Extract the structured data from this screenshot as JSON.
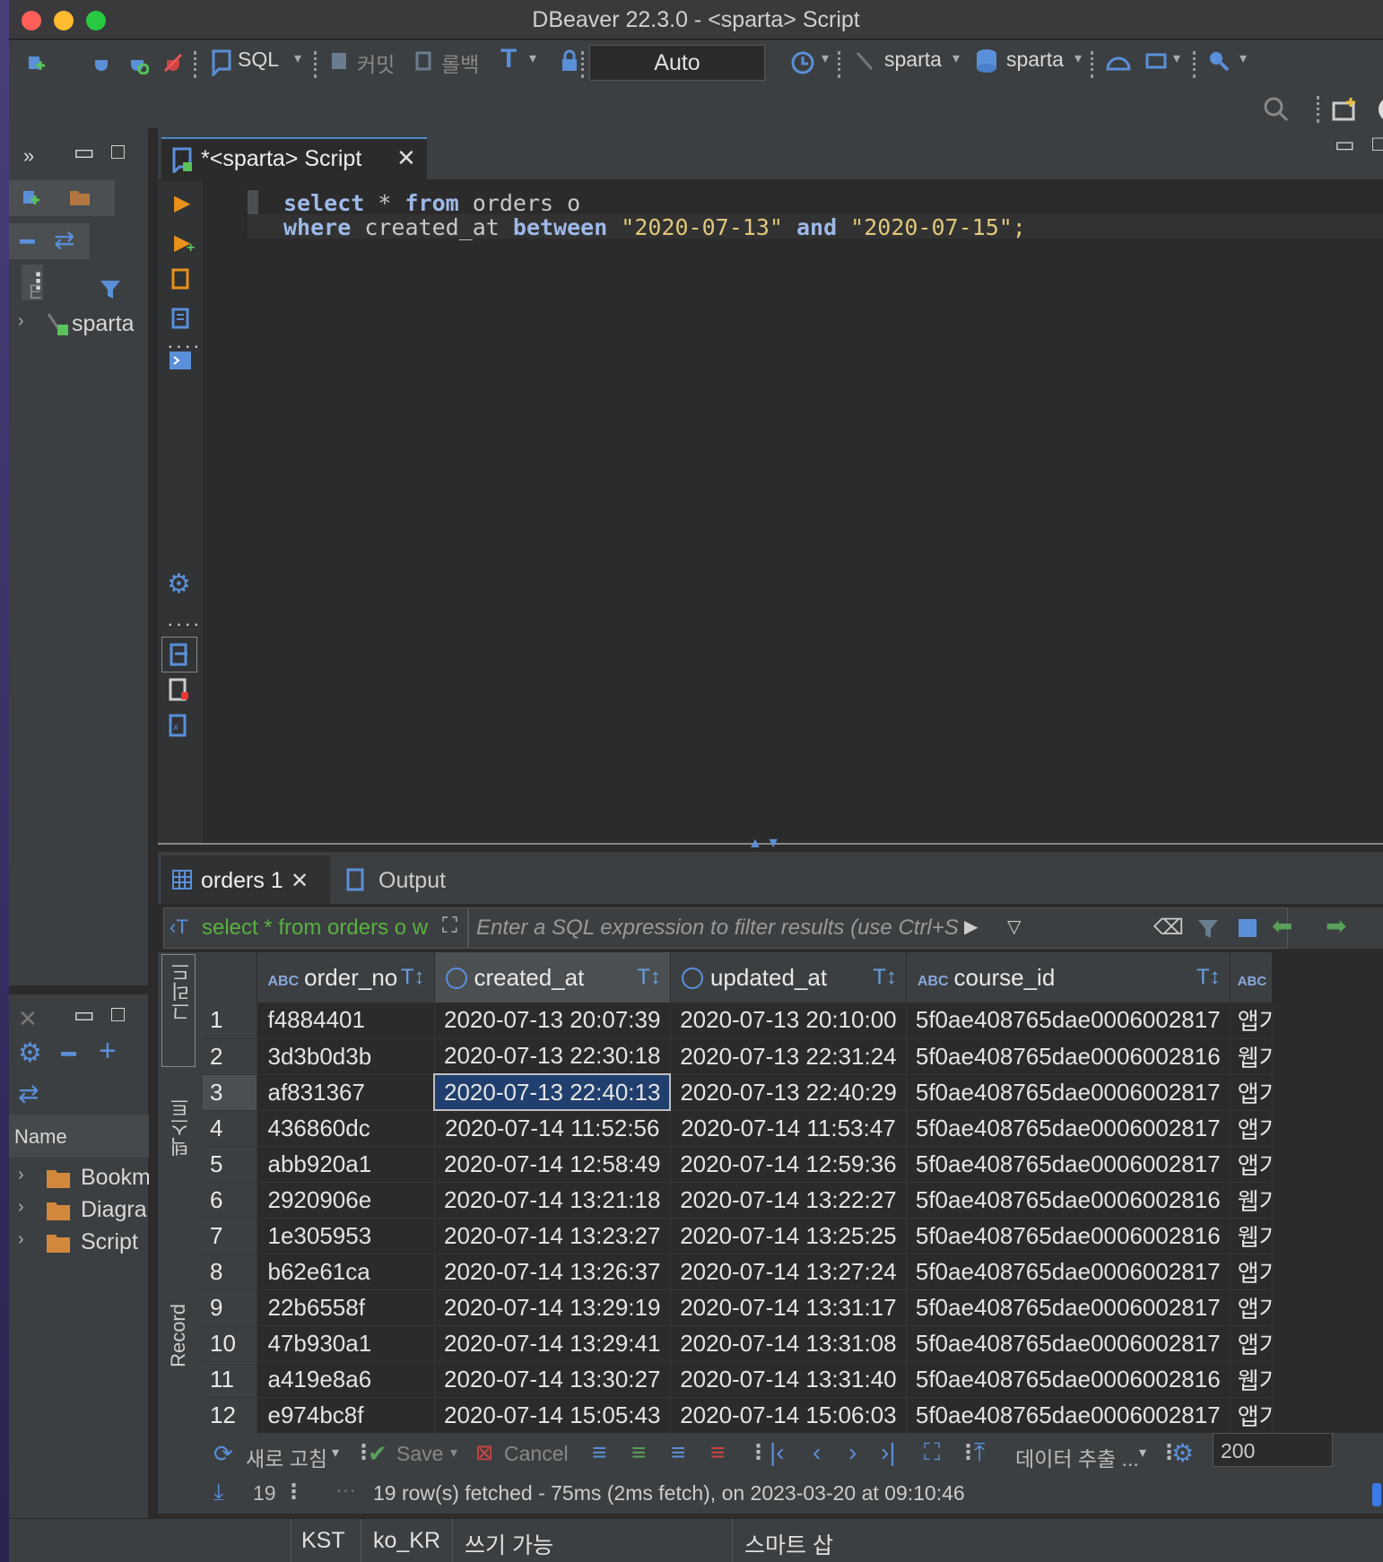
{
  "window": {
    "title": "DBeaver 22.3.0 - <sparta> Script"
  },
  "toolbar": {
    "sql_label": "SQL",
    "commit_label": "커밋",
    "rollback_label": "롤백",
    "transaction_mode": "Auto",
    "connection_name": "sparta",
    "schema_name": "sparta"
  },
  "left_panel": {
    "filter_letter": "E",
    "tree_root": "sparta",
    "projects_header": "Name",
    "project_items": [
      "Bookm",
      "Diagra",
      "Script"
    ]
  },
  "editor": {
    "tab_label": "*<sparta> Script",
    "sql_line1": {
      "kw1": "select",
      "star": " * ",
      "kw2": "from",
      "rest": " orders o"
    },
    "sql_line2": {
      "kw1": "where",
      "col": " created_at ",
      "kw2": "between",
      "s1": " \"2020-07-13\" ",
      "kw3": "and",
      "s2": " \"2020-07-15\";"
    }
  },
  "results": {
    "tab_label": "orders 1",
    "output_tab_label": "Output",
    "query_preview": "select * from orders o w",
    "filter_placeholder": "Enter a SQL expression to filter results (use Ctrl+S",
    "side_grid_label": "그리드",
    "side_text_label": "텍스트",
    "side_record_label": "Record",
    "columns": [
      "order_no",
      "created_at",
      "updated_at",
      "course_id",
      "ABC"
    ],
    "rows": [
      {
        "n": "1",
        "order_no": "f4884401",
        "created_at": "2020-07-13 20:07:39",
        "updated_at": "2020-07-13 20:10:00",
        "course_id": "5f0ae408765dae0006002817",
        "x": "앱기"
      },
      {
        "n": "2",
        "order_no": "3d3b0d3b",
        "created_at": "2020-07-13 22:30:18",
        "updated_at": "2020-07-13 22:31:24",
        "course_id": "5f0ae408765dae0006002816",
        "x": "웹기"
      },
      {
        "n": "3",
        "order_no": "af831367",
        "created_at": "2020-07-13 22:40:13",
        "updated_at": "2020-07-13 22:40:29",
        "course_id": "5f0ae408765dae0006002817",
        "x": "앱기"
      },
      {
        "n": "4",
        "order_no": "436860dc",
        "created_at": "2020-07-14 11:52:56",
        "updated_at": "2020-07-14 11:53:47",
        "course_id": "5f0ae408765dae0006002817",
        "x": "앱기"
      },
      {
        "n": "5",
        "order_no": "abb920a1",
        "created_at": "2020-07-14 12:58:49",
        "updated_at": "2020-07-14 12:59:36",
        "course_id": "5f0ae408765dae0006002817",
        "x": "앱기"
      },
      {
        "n": "6",
        "order_no": "2920906e",
        "created_at": "2020-07-14 13:21:18",
        "updated_at": "2020-07-14 13:22:27",
        "course_id": "5f0ae408765dae0006002816",
        "x": "웹기"
      },
      {
        "n": "7",
        "order_no": "1e305953",
        "created_at": "2020-07-14 13:23:27",
        "updated_at": "2020-07-14 13:25:25",
        "course_id": "5f0ae408765dae0006002816",
        "x": "웹기"
      },
      {
        "n": "8",
        "order_no": "b62e61ca",
        "created_at": "2020-07-14 13:26:37",
        "updated_at": "2020-07-14 13:27:24",
        "course_id": "5f0ae408765dae0006002817",
        "x": "앱기"
      },
      {
        "n": "9",
        "order_no": "22b6558f",
        "created_at": "2020-07-14 13:29:19",
        "updated_at": "2020-07-14 13:31:17",
        "course_id": "5f0ae408765dae0006002817",
        "x": "앱기"
      },
      {
        "n": "10",
        "order_no": "47b930a1",
        "created_at": "2020-07-14 13:29:41",
        "updated_at": "2020-07-14 13:31:08",
        "course_id": "5f0ae408765dae0006002817",
        "x": "앱기"
      },
      {
        "n": "11",
        "order_no": "a419e8a6",
        "created_at": "2020-07-14 13:30:27",
        "updated_at": "2020-07-14 13:31:40",
        "course_id": "5f0ae408765dae0006002816",
        "x": "웹기"
      },
      {
        "n": "12",
        "order_no": "e974bc8f",
        "created_at": "2020-07-14 15:05:43",
        "updated_at": "2020-07-14 15:06:03",
        "course_id": "5f0ae408765dae0006002817",
        "x": "앱기"
      }
    ],
    "selected_cell": {
      "row": 3,
      "column": "created_at"
    }
  },
  "bottom_bar": {
    "refresh_label": "새로 고침",
    "save_label": "Save",
    "cancel_label": "Cancel",
    "export_label": "데이터 추출 ...",
    "fetch_size": "200",
    "row_count": "19",
    "status_message": "19 row(s) fetched - 75ms (2ms fetch), on 2023-03-20 at 09:10:46"
  },
  "status_bar": {
    "timezone": "KST",
    "locale": "ko_KR",
    "write_mode": "쓰기 가능",
    "smart_insert": "스마트 삽"
  },
  "colors": {
    "accent": "#4a88c7",
    "keyword": "#9db9e8",
    "string": "#e0c87a",
    "selection": "#213f6e"
  }
}
